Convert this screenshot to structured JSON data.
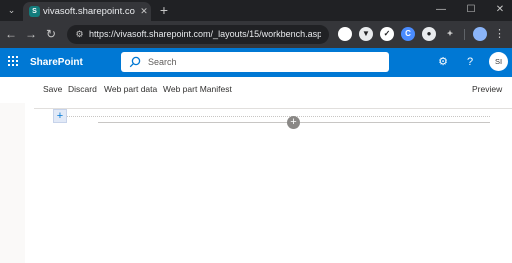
{
  "browser": {
    "tab": {
      "favicon_letter": "S",
      "title": "vivasoft.sharepoint.com/_l"
    },
    "address": "https://vivasoft.sharepoint.com/_layouts/15/workbench.aspx",
    "profile_initial": "",
    "window_controls": {
      "minimize": "—",
      "maximize": "☐",
      "close": "✕"
    }
  },
  "suite": {
    "app_name": "SharePoint",
    "search_placeholder": "Search",
    "user_initials": "SI",
    "brand_color": "#0078d4"
  },
  "commands": [
    "Save",
    "Discard",
    "Web part data",
    "Web part Manifest"
  ],
  "preview_label": "Preview",
  "icons": {
    "section_add": "+",
    "webpart_add": "+"
  }
}
